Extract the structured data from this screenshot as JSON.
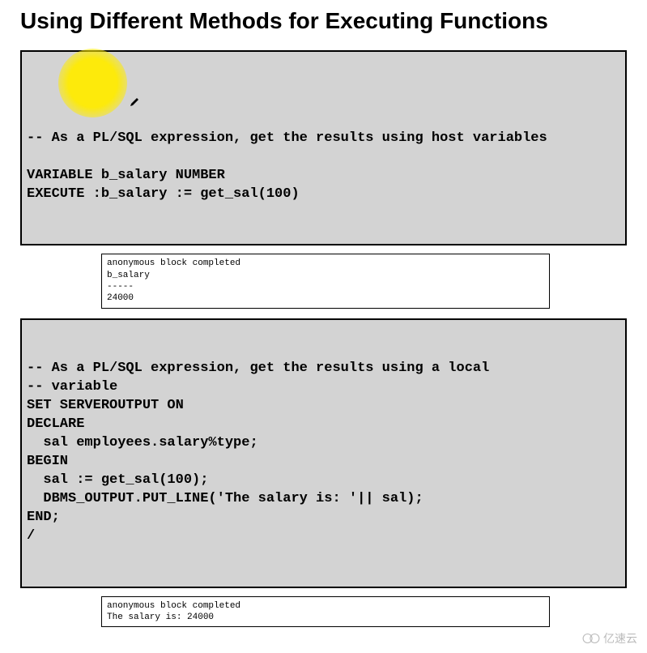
{
  "title": "Using Different Methods for Executing Functions",
  "code_block_1": {
    "text": "-- As a PL/SQL expression, get the results using host variables\n\nVARIABLE b_salary NUMBER\nEXECUTE :b_salary := get_sal(100)"
  },
  "output_1": {
    "text": "anonymous block completed\nb_salary\n-----\n24000"
  },
  "code_block_2": {
    "text": "-- As a PL/SQL expression, get the results using a local\n-- variable\nSET SERVEROUTPUT ON\nDECLARE\n  sal employees.salary%type;\nBEGIN\n  sal := get_sal(100);\n  DBMS_OUTPUT.PUT_LINE('The salary is: '|| sal);\nEND;\n/"
  },
  "output_2": {
    "text": "anonymous block completed\nThe salary is: 24000"
  },
  "watermark": "亿速云"
}
